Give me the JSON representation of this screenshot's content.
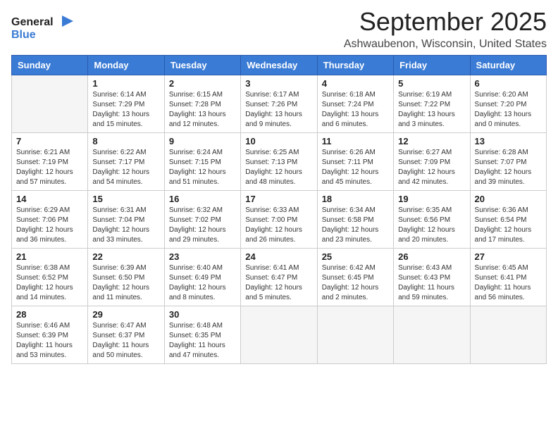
{
  "logo": {
    "line1": "General",
    "line2": "Blue"
  },
  "title": "September 2025",
  "location": "Ashwaubenon, Wisconsin, United States",
  "days_of_week": [
    "Sunday",
    "Monday",
    "Tuesday",
    "Wednesday",
    "Thursday",
    "Friday",
    "Saturday"
  ],
  "weeks": [
    [
      {
        "day": "",
        "sunrise": "",
        "sunset": "",
        "daylight": ""
      },
      {
        "day": "1",
        "sunrise": "6:14 AM",
        "sunset": "7:29 PM",
        "daylight": "13 hours and 15 minutes."
      },
      {
        "day": "2",
        "sunrise": "6:15 AM",
        "sunset": "7:28 PM",
        "daylight": "13 hours and 12 minutes."
      },
      {
        "day": "3",
        "sunrise": "6:17 AM",
        "sunset": "7:26 PM",
        "daylight": "13 hours and 9 minutes."
      },
      {
        "day": "4",
        "sunrise": "6:18 AM",
        "sunset": "7:24 PM",
        "daylight": "13 hours and 6 minutes."
      },
      {
        "day": "5",
        "sunrise": "6:19 AM",
        "sunset": "7:22 PM",
        "daylight": "13 hours and 3 minutes."
      },
      {
        "day": "6",
        "sunrise": "6:20 AM",
        "sunset": "7:20 PM",
        "daylight": "13 hours and 0 minutes."
      }
    ],
    [
      {
        "day": "7",
        "sunrise": "6:21 AM",
        "sunset": "7:19 PM",
        "daylight": "12 hours and 57 minutes."
      },
      {
        "day": "8",
        "sunrise": "6:22 AM",
        "sunset": "7:17 PM",
        "daylight": "12 hours and 54 minutes."
      },
      {
        "day": "9",
        "sunrise": "6:24 AM",
        "sunset": "7:15 PM",
        "daylight": "12 hours and 51 minutes."
      },
      {
        "day": "10",
        "sunrise": "6:25 AM",
        "sunset": "7:13 PM",
        "daylight": "12 hours and 48 minutes."
      },
      {
        "day": "11",
        "sunrise": "6:26 AM",
        "sunset": "7:11 PM",
        "daylight": "12 hours and 45 minutes."
      },
      {
        "day": "12",
        "sunrise": "6:27 AM",
        "sunset": "7:09 PM",
        "daylight": "12 hours and 42 minutes."
      },
      {
        "day": "13",
        "sunrise": "6:28 AM",
        "sunset": "7:07 PM",
        "daylight": "12 hours and 39 minutes."
      }
    ],
    [
      {
        "day": "14",
        "sunrise": "6:29 AM",
        "sunset": "7:06 PM",
        "daylight": "12 hours and 36 minutes."
      },
      {
        "day": "15",
        "sunrise": "6:31 AM",
        "sunset": "7:04 PM",
        "daylight": "12 hours and 33 minutes."
      },
      {
        "day": "16",
        "sunrise": "6:32 AM",
        "sunset": "7:02 PM",
        "daylight": "12 hours and 29 minutes."
      },
      {
        "day": "17",
        "sunrise": "6:33 AM",
        "sunset": "7:00 PM",
        "daylight": "12 hours and 26 minutes."
      },
      {
        "day": "18",
        "sunrise": "6:34 AM",
        "sunset": "6:58 PM",
        "daylight": "12 hours and 23 minutes."
      },
      {
        "day": "19",
        "sunrise": "6:35 AM",
        "sunset": "6:56 PM",
        "daylight": "12 hours and 20 minutes."
      },
      {
        "day": "20",
        "sunrise": "6:36 AM",
        "sunset": "6:54 PM",
        "daylight": "12 hours and 17 minutes."
      }
    ],
    [
      {
        "day": "21",
        "sunrise": "6:38 AM",
        "sunset": "6:52 PM",
        "daylight": "12 hours and 14 minutes."
      },
      {
        "day": "22",
        "sunrise": "6:39 AM",
        "sunset": "6:50 PM",
        "daylight": "12 hours and 11 minutes."
      },
      {
        "day": "23",
        "sunrise": "6:40 AM",
        "sunset": "6:49 PM",
        "daylight": "12 hours and 8 minutes."
      },
      {
        "day": "24",
        "sunrise": "6:41 AM",
        "sunset": "6:47 PM",
        "daylight": "12 hours and 5 minutes."
      },
      {
        "day": "25",
        "sunrise": "6:42 AM",
        "sunset": "6:45 PM",
        "daylight": "12 hours and 2 minutes."
      },
      {
        "day": "26",
        "sunrise": "6:43 AM",
        "sunset": "6:43 PM",
        "daylight": "11 hours and 59 minutes."
      },
      {
        "day": "27",
        "sunrise": "6:45 AM",
        "sunset": "6:41 PM",
        "daylight": "11 hours and 56 minutes."
      }
    ],
    [
      {
        "day": "28",
        "sunrise": "6:46 AM",
        "sunset": "6:39 PM",
        "daylight": "11 hours and 53 minutes."
      },
      {
        "day": "29",
        "sunrise": "6:47 AM",
        "sunset": "6:37 PM",
        "daylight": "11 hours and 50 minutes."
      },
      {
        "day": "30",
        "sunrise": "6:48 AM",
        "sunset": "6:35 PM",
        "daylight": "11 hours and 47 minutes."
      },
      {
        "day": "",
        "sunrise": "",
        "sunset": "",
        "daylight": ""
      },
      {
        "day": "",
        "sunrise": "",
        "sunset": "",
        "daylight": ""
      },
      {
        "day": "",
        "sunrise": "",
        "sunset": "",
        "daylight": ""
      },
      {
        "day": "",
        "sunrise": "",
        "sunset": "",
        "daylight": ""
      }
    ]
  ],
  "labels": {
    "sunrise_prefix": "Sunrise: ",
    "sunset_prefix": "Sunset: ",
    "daylight_prefix": "Daylight: "
  }
}
